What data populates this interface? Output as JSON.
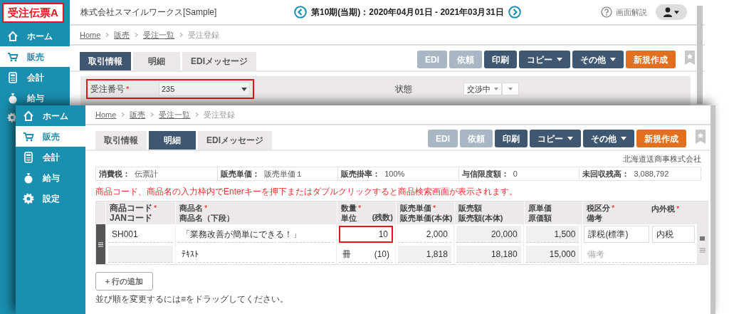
{
  "callout": {
    "text": "受注伝票A"
  },
  "back_window": {
    "company": "株式会社スマイルワークス[Sample]",
    "period": "第10期(当期)：2020年04月01日 - 2021年03月31日",
    "help": "画面解説",
    "sidebar": [
      {
        "label": "ホーム",
        "selected": false
      },
      {
        "label": "販売",
        "selected": true
      },
      {
        "label": "会計",
        "selected": false
      },
      {
        "label": "給与",
        "selected": false
      }
    ],
    "breadcrumb": [
      {
        "label": "Home",
        "current": false
      },
      {
        "label": "販売",
        "current": false
      },
      {
        "label": "受注一覧",
        "current": false
      },
      {
        "label": "受注登録",
        "current": true
      }
    ],
    "tabs": [
      {
        "label": "取引情報",
        "selected": true
      },
      {
        "label": "明細",
        "selected": false
      },
      {
        "label": "EDIメッセージ",
        "selected": false
      }
    ],
    "actions": [
      {
        "label": "EDI",
        "kind": "disabled"
      },
      {
        "label": "依頼",
        "kind": "disabled"
      },
      {
        "label": "印刷",
        "kind": "default"
      },
      {
        "label": "コピー",
        "kind": "dropdown"
      },
      {
        "label": "その他",
        "kind": "dropdown"
      },
      {
        "label": "新規作成",
        "kind": "create"
      }
    ],
    "form": [
      {
        "label": "受注番号",
        "mark": "*",
        "value": "235",
        "kind": "select",
        "highlighted": true
      },
      {
        "label": "状態",
        "value": "交渉中",
        "kind": "split-select",
        "highlighted": false
      }
    ]
  },
  "front_window": {
    "sidebar": [
      {
        "label": "ホーム",
        "selected": false
      },
      {
        "label": "販売",
        "selected": true
      },
      {
        "label": "会計",
        "selected": false
      },
      {
        "label": "給与",
        "selected": false
      },
      {
        "label": "設定",
        "selected": false
      }
    ],
    "breadcrumb": [
      {
        "label": "Home",
        "current": false
      },
      {
        "label": "販売",
        "current": false
      },
      {
        "label": "受注一覧",
        "current": false
      },
      {
        "label": "受注登録",
        "current": true
      }
    ],
    "tabs": [
      {
        "label": "取引情報",
        "selected": false
      },
      {
        "label": "明細",
        "selected": true
      },
      {
        "label": "EDIメッセージ",
        "selected": false
      }
    ],
    "actions": [
      {
        "label": "EDI",
        "kind": "disabled"
      },
      {
        "label": "依頼",
        "kind": "disabled"
      },
      {
        "label": "印刷",
        "kind": "default"
      },
      {
        "label": "コピー",
        "kind": "dropdown"
      },
      {
        "label": "その他",
        "kind": "dropdown"
      },
      {
        "label": "新規作成",
        "kind": "create"
      }
    ],
    "customer": "北海道送商事株式会社",
    "info": [
      {
        "label": "消費税：",
        "value": "伝票計"
      },
      {
        "label": "販売単価：",
        "value": "販売単価１"
      },
      {
        "label": "販売掛率：",
        "value": "100%"
      },
      {
        "label": "与信限度額：",
        "value": "0"
      },
      {
        "label": "未回収残高：",
        "value": "3,088,792"
      }
    ],
    "notice": "商品コード、商品名の入力枠内でEnterキーを押下またはダブルクリックすると商品検索画面が表示されます。",
    "table": {
      "columns": [
        {
          "lines": [
            {
              "text": "商品コード",
              "mark": "*"
            },
            {
              "text": "JANコード"
            }
          ]
        },
        {
          "lines": [
            {
              "text": "商品名",
              "mark": "*"
            },
            {
              "text": "商品名（下段）"
            }
          ]
        },
        {
          "lines": [
            {
              "text": "数量",
              "mark": "*"
            },
            {
              "text": "単位"
            }
          ],
          "aside": {
            "text": "(残数)"
          }
        },
        {
          "lines": [
            {
              "text": "販売単価",
              "mark": "*"
            },
            {
              "text": "販売単価(本体)"
            }
          ]
        },
        {
          "lines": [
            {
              "text": "販売額"
            },
            {
              "text": "販売額(本体)"
            }
          ]
        },
        {
          "lines": [
            {
              "text": "原単価"
            },
            {
              "text": "原価額"
            }
          ]
        },
        {
          "lines": [
            {
              "text": "税区分",
              "mark": "*"
            },
            {
              "text": "備考"
            }
          ],
          "aside": {
            "text": "内外税",
            "mark": "*"
          }
        }
      ],
      "rows": [
        {
          "cells": [
            {
              "top": [
                {
                  "value": "SH001",
                  "readonly": false,
                  "highlighted": false
                }
              ],
              "bottom": [
                {
                  "readonly": true,
                  "highlighted": false
                }
              ]
            },
            {
              "top": [
                {
                  "value": "「業務改善が簡単にできる！」",
                  "readonly": false,
                  "highlighted": false
                }
              ],
              "bottom": [
                {
                  "value": "ﾃｷｽﾄ",
                  "readonly": false,
                  "highlighted": false
                }
              ]
            },
            {
              "top": [
                {
                  "value": "10",
                  "readonly": false,
                  "highlighted": true
                }
              ],
              "bottom": [
                {
                  "value": "冊",
                  "readonly": false,
                  "highlighted": false
                },
                {
                  "value": "(10)",
                  "readonly": false,
                  "highlighted": false
                }
              ]
            },
            {
              "top": [
                {
                  "value": "2,000",
                  "readonly": false,
                  "highlighted": false
                }
              ],
              "bottom": [
                {
                  "value": "1,818",
                  "readonly": true,
                  "highlighted": false
                }
              ]
            },
            {
              "top": [
                {
                  "value": "20,000",
                  "readonly": true,
                  "highlighted": false
                }
              ],
              "bottom": [
                {
                  "value": "18,180",
                  "readonly": true,
                  "highlighted": false
                }
              ]
            },
            {
              "top": [
                {
                  "value": "1,500",
                  "readonly": true,
                  "highlighted": false
                }
              ],
              "bottom": [
                {
                  "value": "15,000",
                  "readonly": true,
                  "highlighted": false
                }
              ]
            },
            {
              "top": [
                {
                  "value": "課税(標準)",
                  "readonly": false,
                  "highlighted": false
                },
                {
                  "value": "内税",
                  "readonly": false,
                  "highlighted": false
                }
              ],
              "bottom": [
                {
                  "placeholder": "備考",
                  "readonly": false,
                  "highlighted": false
                }
              ]
            }
          ]
        }
      ]
    },
    "add_row": "+ 行の追加",
    "hint": "並び順を変更するには≡をドラッグしてください。"
  }
}
